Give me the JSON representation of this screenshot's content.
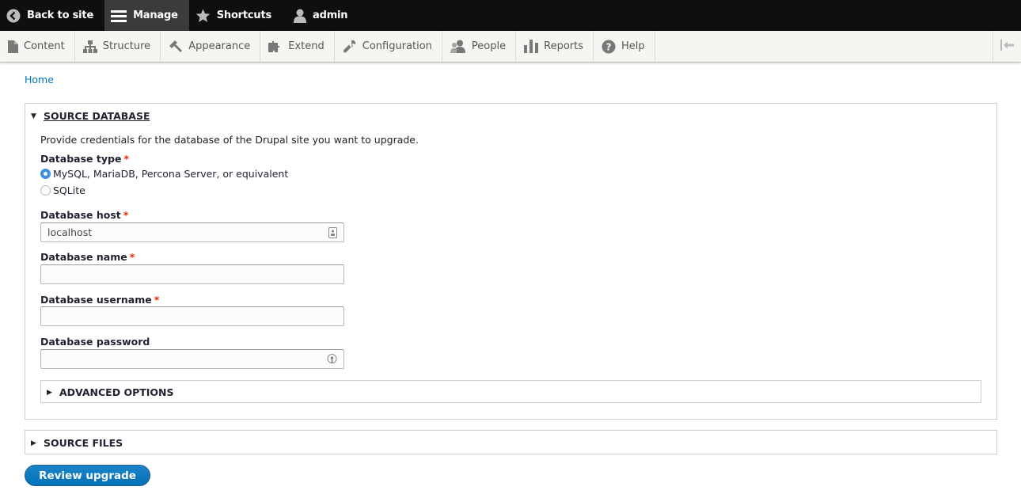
{
  "toolbar": {
    "back_to_site": "Back to site",
    "manage": "Manage",
    "shortcuts": "Shortcuts",
    "user": "admin"
  },
  "tray": {
    "items": [
      {
        "label": "Content",
        "icon": "page-icon"
      },
      {
        "label": "Structure",
        "icon": "sitemap-icon"
      },
      {
        "label": "Appearance",
        "icon": "paintbrush-icon"
      },
      {
        "label": "Extend",
        "icon": "puzzle-icon"
      },
      {
        "label": "Configuration",
        "icon": "wrench-icon"
      },
      {
        "label": "People",
        "icon": "people-icon"
      },
      {
        "label": "Reports",
        "icon": "bar-chart-icon"
      },
      {
        "label": "Help",
        "icon": "help-icon"
      }
    ]
  },
  "breadcrumb": {
    "home": "Home"
  },
  "source_database": {
    "title": "Source database",
    "description": "Provide credentials for the database of the Drupal site you want to upgrade.",
    "db_type_label": "Database type",
    "options": [
      "MySQL, MariaDB, Percona Server, or equivalent",
      "SQLite"
    ],
    "selected_option": "MySQL, MariaDB, Percona Server, or equivalent",
    "host_label": "Database host",
    "host_value": "localhost",
    "name_label": "Database name",
    "name_value": "",
    "username_label": "Database username",
    "username_value": "",
    "password_label": "Database password",
    "password_value": "",
    "advanced_title": "Advanced options"
  },
  "source_files": {
    "title": "Source files"
  },
  "submit": {
    "label": "Review upgrade"
  },
  "colors": {
    "toolbar_bg": "#0f0f0f",
    "tray_bg": "#f5f5f2",
    "link": "#0074bd",
    "required": "#e32700",
    "primary_button": "#0071b8",
    "radio_checked": "#3d8fe0"
  }
}
